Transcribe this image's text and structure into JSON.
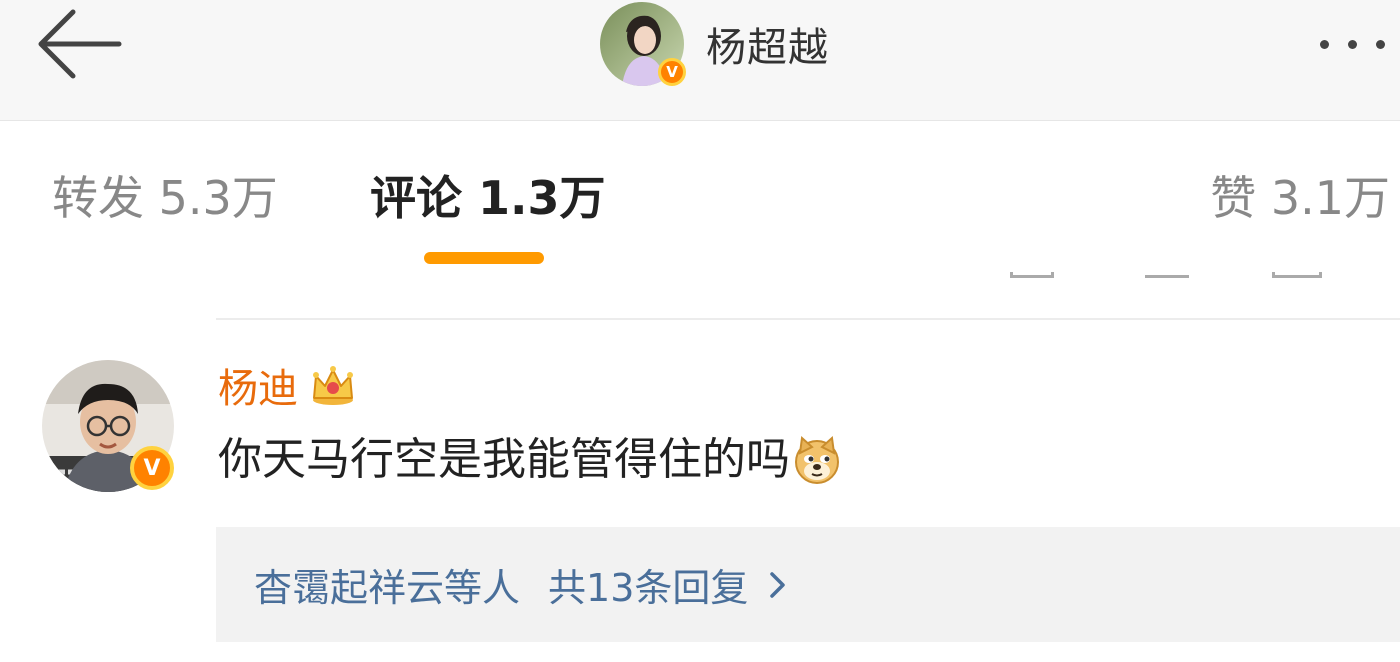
{
  "header": {
    "title": "杨超越",
    "verified_badge": "V"
  },
  "tabs": [
    {
      "label": "转发 5.3万"
    },
    {
      "label": "评论 1.3万"
    },
    {
      "label": "赞 3.1万"
    }
  ],
  "comment": {
    "author": "杨迪",
    "verified_badge": "V",
    "text": "你天马行空是我能管得住的吗",
    "emoji_icon": "doge-icon",
    "crown_icon": "crown-icon",
    "replies": {
      "repliers": "杳霭起祥云等人",
      "count_label": "共13条回复"
    }
  },
  "colors": {
    "accent": "#ff9a00",
    "author_name": "#e86b0c",
    "reply_link": "#4a6f9a",
    "verified": "#ff8200"
  }
}
